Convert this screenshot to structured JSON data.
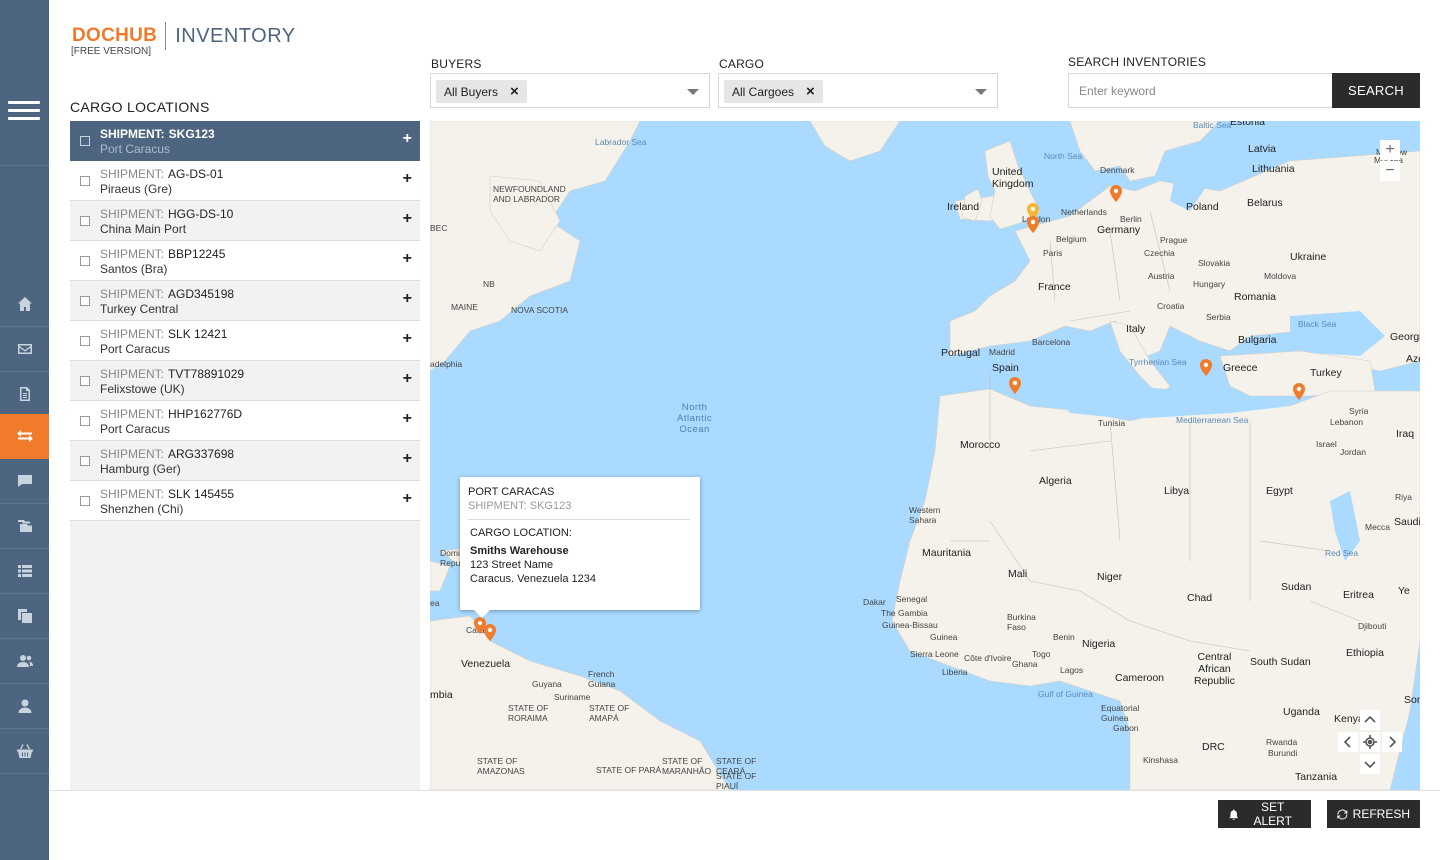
{
  "app": {
    "brand": "DOCHUB",
    "module": "INVENTORY",
    "edition": "[FREE VERSION]"
  },
  "sidebar": {
    "items": [
      {
        "name": "home",
        "icon": "home-icon"
      },
      {
        "name": "mail",
        "icon": "mail-icon"
      },
      {
        "name": "documents",
        "icon": "document-icon"
      },
      {
        "name": "transfers",
        "icon": "transfer-icon",
        "active": true
      },
      {
        "name": "messages",
        "icon": "chat-icon"
      },
      {
        "name": "files",
        "icon": "files-icon"
      },
      {
        "name": "list",
        "icon": "list-icon"
      },
      {
        "name": "copies",
        "icon": "copy-icon"
      },
      {
        "name": "users",
        "icon": "users-icon"
      },
      {
        "name": "profile",
        "icon": "user-icon"
      },
      {
        "name": "basket",
        "icon": "basket-icon"
      }
    ]
  },
  "filters": {
    "buyers_label": "BUYERS",
    "buyers_value": "All Buyers",
    "cargo_label": "CARGO",
    "cargo_value": "All Cargoes",
    "search_label": "SEARCH INVENTORIES",
    "search_placeholder": "Enter keyword",
    "search_value": "",
    "search_button": "SEARCH"
  },
  "cargo": {
    "title": "CARGO LOCATIONS",
    "shipment_key": "SHIPMENT:",
    "rows": [
      {
        "id": "SKG123",
        "port": "Port Caracus"
      },
      {
        "id": "AG-DS-01",
        "port": "Piraeus (Gre)"
      },
      {
        "id": "HGG-DS-10",
        "port": "China Main Port"
      },
      {
        "id": "BBP12245",
        "port": "Santos (Bra)"
      },
      {
        "id": "AGD345198",
        "port": "Turkey Central"
      },
      {
        "id": "SLK 12421",
        "port": "Port Caracus"
      },
      {
        "id": "TVT78891029",
        "port": "Felixstowe (UK)"
      },
      {
        "id": "HHP162776D",
        "port": "Port Caracus"
      },
      {
        "id": "ARG337698",
        "port": "Hamburg (Ger)"
      },
      {
        "id": "SLK 145455",
        "port": "Shenzhen (Chi)"
      }
    ]
  },
  "map": {
    "zoom_in": "+",
    "zoom_out": "−",
    "pin_color": "#f07b2a",
    "labels": {
      "labrador_sea": "Labrador Sea",
      "baltic_sea": "Baltic Sea",
      "north_sea": "North Sea",
      "estonia": "Estonia",
      "latvia": "Latvia",
      "lithuania": "Lithuania",
      "moscow": "Moscow",
      "moscow_ru": "Москва",
      "denmark": "Denmark",
      "united_kingdom": "United\nKingdom",
      "ireland": "Ireland",
      "london": "London",
      "netherlands": "Netherlands",
      "berlin": "Berlin",
      "poland": "Poland",
      "belarus": "Belarus",
      "germany": "Germany",
      "belgium": "Belgium",
      "prague": "Prague",
      "czechia": "Czechia",
      "ukraine": "Ukraine",
      "paris": "Paris",
      "slovakia": "Slovakia",
      "austria": "Austria",
      "moldova": "Moldova",
      "hungary": "Hungary",
      "france": "France",
      "romania": "Romania",
      "croatia": "Croatia",
      "serbia": "Serbia",
      "black_sea": "Black Sea",
      "georgia": "Georgia",
      "italy": "Italy",
      "barcelona": "Barcelona",
      "portugal": "Portugal",
      "madrid": "Madrid",
      "bulgaria": "Bulgaria",
      "spain": "Spain",
      "tyrrhenian_sea": "Tyrrhenian Sea",
      "greece": "Greece",
      "turkey": "Turkey",
      "aze": "Aze",
      "syria": "Syria",
      "mediterranean_sea": "Mediterranean Sea",
      "tunisia": "Tunisia",
      "lebanon": "Lebanon",
      "iraq": "Iraq",
      "israel": "Israel",
      "jordan": "Jordan",
      "morocco": "Morocco",
      "algeria": "Algeria",
      "libya": "Libya",
      "egypt": "Egypt",
      "riya": "Riya",
      "western_sahara": "Western\nSahara",
      "mecca": "Mecca",
      "saudi_ara": "Saudi Ara",
      "red_sea": "Red Sea",
      "mauritania": "Mauritania",
      "mali": "Mali",
      "niger": "Niger",
      "sudan": "Sudan",
      "chad": "Chad",
      "eritrea": "Eritrea",
      "ye": "Ye",
      "dakar": "Dakar",
      "senegal": "Senegal",
      "the_gambia": "The Gambia",
      "guinea_bissau": "Guinea-Bissau",
      "burkina_faso": "Burkina\nFaso",
      "djibouti": "Djibouti",
      "guinea": "Guinea",
      "benin": "Benin",
      "nigeria": "Nigeria",
      "ethiopia": "Ethiopia",
      "sierra_leone": "Sierra Leone",
      "cote_divoire": "Côte d'Ivoire",
      "ghana": "Ghana",
      "togo": "Togo",
      "lagos": "Lagos",
      "south_sudan": "South Sudan",
      "central_african_republic": "Central\nAfrican\nRepublic",
      "liberia": "Liberia",
      "cameroon": "Cameroon",
      "somali": "Somali",
      "gulf_of_guinea": "Gulf of Guinea",
      "equatorial_guinea": "Equatorial\nGuinea",
      "gabon": "Gabon",
      "uganda": "Uganda",
      "kenya": "Kenya",
      "drc": "DRC",
      "rwanda": "Rwanda",
      "burundi": "Burundi",
      "kinshasa": "Kinshasa",
      "tanzania": "Tanzania",
      "north_atlantic_ocean": "North\nAtlantic\nOcean",
      "newfoundland": "NEWFOUNDLAND\nAND LABRADOR",
      "nova_scotia": "NOVA SCOTIA",
      "maine": "MAINE",
      "nb": "NB",
      "bec": "BEC",
      "adelphia": "adelphia",
      "dominican_republic": "Dominican\nRepubl",
      "sea_frag": "ea",
      "venezuela": "Venezuela",
      "caracas": "Cara",
      "guyana": "Guyana",
      "suriname": "Suriname",
      "french_guiana": "French\nGuiana",
      "colombia": "mbia",
      "roraima": "STATE OF\nRORAIMA",
      "amapa": "STATE OF\nAMAPÁ",
      "amazonas": "STATE OF\nAMAZONAS",
      "para": "STATE OF PARÁ",
      "maranhao": "STATE OF\nMARANHÃO",
      "ceara": "STATE OF\nCEARÁ",
      "piaui": "STATE OF\nPIAUÍ"
    }
  },
  "popup": {
    "title": "PORT CARACAS",
    "subtitle": "SHIPMENT: SKG123",
    "location_label": "CARGO LOCATION:",
    "name": "Smiths Warehouse",
    "address_line1": "123 Street Name",
    "address_line2": "Caracus. Venezuela 1234"
  },
  "footer": {
    "set_alert": "SET ALERT",
    "refresh": "REFRESH"
  },
  "colors": {
    "accent": "#f07b2a",
    "sidebar": "#4d6580",
    "dark_button": "#2b2b2b",
    "water": "#aadaff",
    "land": "#f4f2ea"
  }
}
